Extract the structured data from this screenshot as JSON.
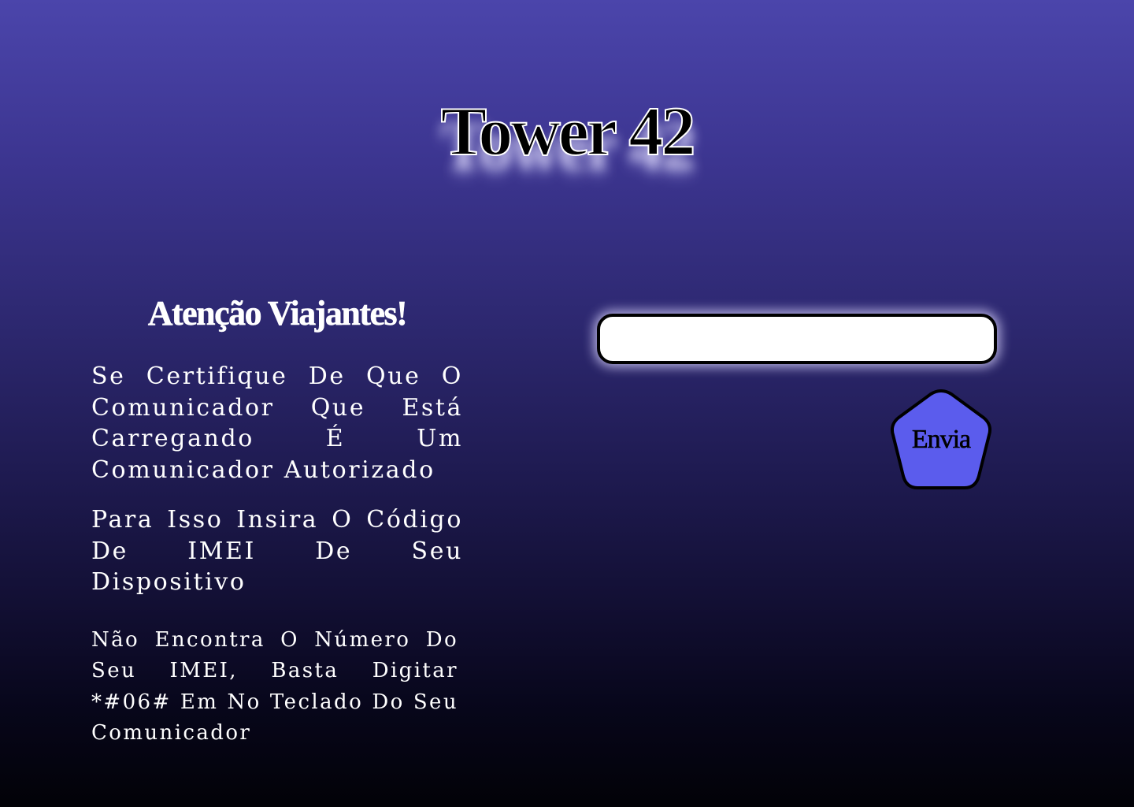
{
  "header": {
    "title": "Tower 42"
  },
  "notice": {
    "heading": "Atenção Viajantes!",
    "paragraph_1": "Se Certifique De Que O Comunicador Que Está Carregando É Um Comunicador Autorizado",
    "paragraph_2": "Para Isso Insira O Código De IMEI De Seu Dispositivo",
    "paragraph_3": "Não Encontra O Número Do Seu IMEI, Basta Digitar *#06# Em No Teclado Do Seu Comunicador"
  },
  "form": {
    "imei_value": "",
    "imei_placeholder": "",
    "submit_label": "Envia"
  },
  "colors": {
    "background_top": "#4b45ab",
    "background_bottom": "#020207",
    "button_fill": "#5b5ced",
    "input_fill": "#ffffff",
    "outline": "#000000"
  }
}
